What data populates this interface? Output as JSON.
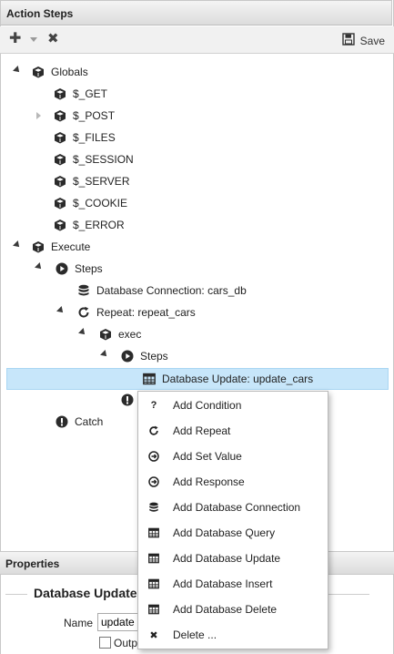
{
  "panel": {
    "title": "Action Steps"
  },
  "toolbar": {
    "save_label": "Save"
  },
  "tree": {
    "globals": "Globals",
    "get": "$_GET",
    "post": "$_POST",
    "files": "$_FILES",
    "session": "$_SESSION",
    "server": "$_SERVER",
    "cookie": "$_COOKIE",
    "error": "$_ERROR",
    "execute": "Execute",
    "steps": "Steps",
    "db_connection": "Database Connection: cars_db",
    "repeat": "Repeat: repeat_cars",
    "exec": "exec",
    "inner_steps": "Steps",
    "db_update": "Database Update: update_cars",
    "catch": "Catch"
  },
  "context_menu": {
    "items": [
      {
        "label": "Add Condition",
        "icon": "question-icon"
      },
      {
        "label": "Add Repeat",
        "icon": "repeat-icon"
      },
      {
        "label": "Add Set Value",
        "icon": "set-value-icon"
      },
      {
        "label": "Add Response",
        "icon": "response-icon"
      },
      {
        "label": "Add Database Connection",
        "icon": "database-icon"
      },
      {
        "label": "Add Database Query",
        "icon": "table-icon"
      },
      {
        "label": "Add Database Update",
        "icon": "table-icon"
      },
      {
        "label": "Add Database Insert",
        "icon": "table-icon"
      },
      {
        "label": "Add Database Delete",
        "icon": "table-icon"
      },
      {
        "label": "Delete ...",
        "icon": "delete-icon"
      }
    ]
  },
  "properties": {
    "title": "Properties",
    "section_title": "Database Update",
    "name_label": "Name",
    "name_value": "update",
    "output_label": "Outp"
  },
  "colors": {
    "selection": "#c7e6fa",
    "header_bg": "#e6e6e6"
  }
}
